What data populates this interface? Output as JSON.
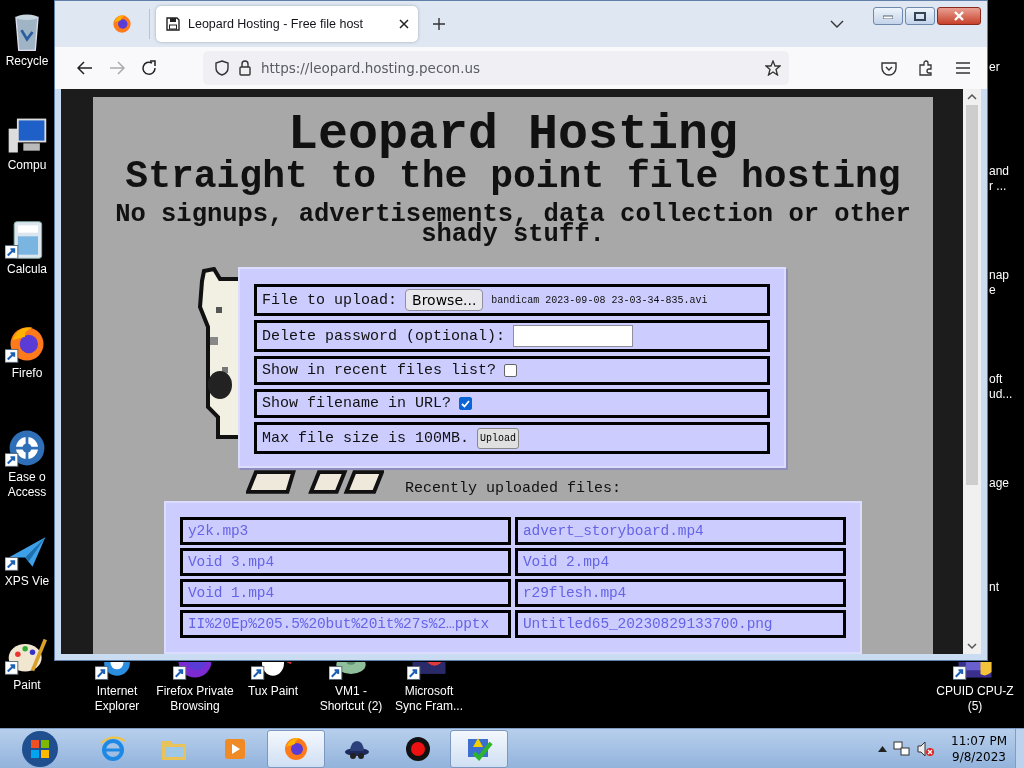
{
  "desktop": {
    "left_icons": [
      {
        "kind": "recycle-bin",
        "shortcut": false,
        "lines": [
          "Recycle"
        ]
      },
      {
        "kind": "computer",
        "shortcut": false,
        "lines": [
          "Compu"
        ]
      },
      {
        "kind": "calculator",
        "shortcut": true,
        "lines": [
          "Calcula"
        ]
      },
      {
        "kind": "firefox",
        "shortcut": true,
        "lines": [
          "Firefo"
        ]
      },
      {
        "kind": "ease-of-access",
        "shortcut": true,
        "lines": [
          "Ease o",
          "Access"
        ]
      },
      {
        "kind": "paper-plane",
        "shortcut": true,
        "lines": [
          "XPS Vie"
        ]
      },
      {
        "kind": "palette",
        "shortcut": true,
        "lines": [
          "Paint"
        ]
      }
    ],
    "bottom_icons": [
      {
        "kind": "internet-explorer",
        "shortcut": true,
        "lines": [
          "Internet",
          "Explorer"
        ]
      },
      {
        "kind": "firefox-private",
        "shortcut": true,
        "lines": [
          "Firefox Private",
          "Browsing"
        ]
      },
      {
        "kind": "tux-paint",
        "shortcut": true,
        "lines": [
          "Tux Paint"
        ]
      },
      {
        "kind": "vm",
        "shortcut": true,
        "lines": [
          "VM1 -",
          "Shortcut (2)"
        ]
      },
      {
        "kind": "sync",
        "shortcut": true,
        "lines": [
          "Microsoft",
          "Sync Fram..."
        ]
      }
    ],
    "right_labels": [
      [
        "er"
      ],
      [
        "and",
        "r ..."
      ],
      [
        "nap",
        "e"
      ],
      [
        "oft",
        "ud..."
      ],
      [
        "age"
      ],
      [
        "nt"
      ]
    ],
    "corner_icon": {
      "kind": "cpu-z",
      "shortcut": true,
      "lines": [
        "CPUID CPU-Z",
        "(5)"
      ]
    }
  },
  "browser": {
    "tab": {
      "title": "Leopard Hosting - Free file host",
      "selected": true
    },
    "url": "https://leopard.hosting.pecon.us"
  },
  "page": {
    "title": "Leopard Hosting",
    "subtitle": "Straight to the point file hosting",
    "tagline": "No signups, advertisements, data collection or other shady stuff.",
    "form": {
      "file_label": "File to upload:",
      "browse_button": "Browse...",
      "file_name": "bandicam 2023-09-08 23-03-34-835.avi",
      "password_label": "Delete password (optional):",
      "recent_label": "Show in recent files list?",
      "recent_checked": false,
      "filename_label": "Show filename in URL?",
      "filename_checked": true,
      "max_size": "Max file size is 100MB.",
      "upload_button": "Upload"
    },
    "recent_heading": "Recently uploaded files:",
    "recent_files": [
      "y2k.mp3",
      "advert_storyboard.mp4",
      "Void 3.mp4",
      "Void 2.mp4",
      "Void 1.mp4",
      "r29flesh.mp4",
      "II%20Ep%205.5%20but%20it%27s%2…pptx",
      "Untitled65_20230829133700.png"
    ]
  },
  "taskbar": {
    "items": [
      {
        "kind": "internet-explorer",
        "selected": false
      },
      {
        "kind": "folder",
        "selected": false
      },
      {
        "kind": "media-player",
        "selected": false
      },
      {
        "kind": "firefox",
        "selected": true
      },
      {
        "kind": "hat",
        "selected": false
      },
      {
        "kind": "record",
        "selected": false
      },
      {
        "kind": "checklist",
        "selected": true
      }
    ],
    "time": "11:07 PM",
    "date": "9/8/2023"
  }
}
